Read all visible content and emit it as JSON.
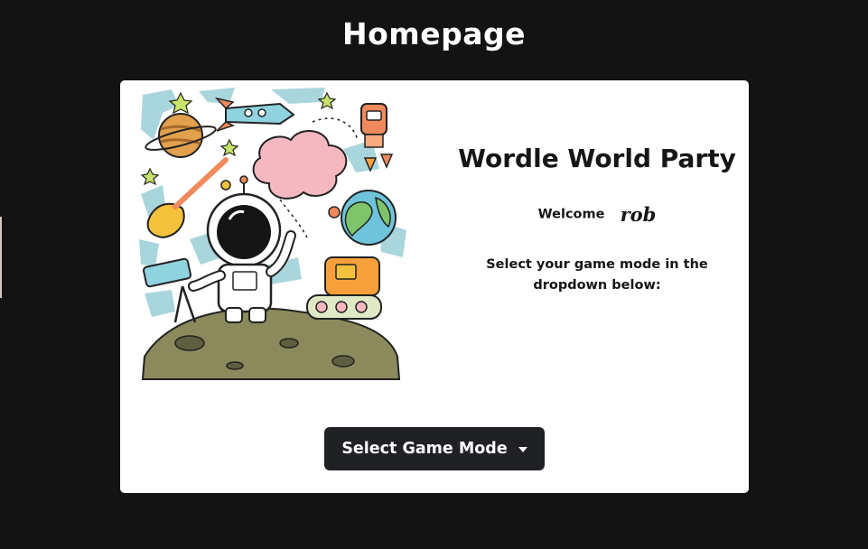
{
  "page": {
    "title": "Homepage"
  },
  "card": {
    "game_title": "Wordle World Party",
    "welcome_label": "Welcome",
    "username": "rob",
    "instructions": "Select your game mode in the dropdown below:",
    "dropdown": {
      "label": "Select Game Mode",
      "icon": "caret-down-icon"
    },
    "illustration": "astronaut-space-doodle"
  },
  "colors": {
    "background": "#131313",
    "card": "#ffffff",
    "button": "#1f2125",
    "text": "#161616"
  }
}
